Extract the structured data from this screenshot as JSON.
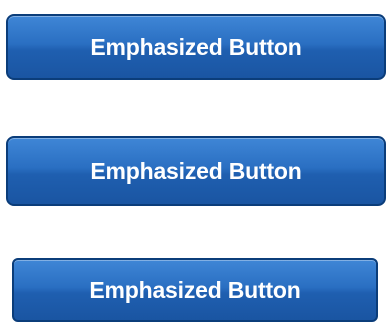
{
  "buttons": [
    {
      "label": "Emphasized Button"
    },
    {
      "label": "Emphasized Button"
    },
    {
      "label": "Emphasized Button"
    }
  ],
  "colors": {
    "button_top": "#3f86d6",
    "button_bottom": "#1a55a2",
    "button_border": "#0b3d7a",
    "label": "#ffffff"
  }
}
